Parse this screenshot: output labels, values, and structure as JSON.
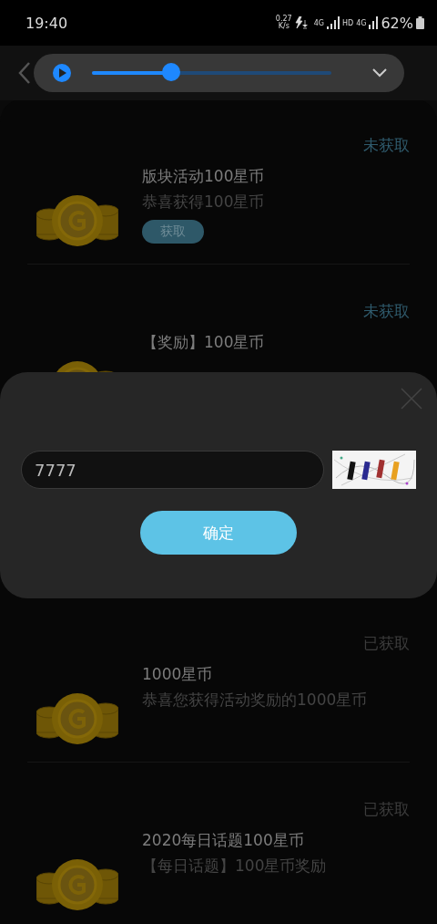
{
  "status_bar": {
    "time": "19:40",
    "speed": "0.27",
    "speed_unit": "K/s",
    "network_a": "4G",
    "network_b": "HD",
    "network_c": "4G",
    "battery": "62%"
  },
  "media": {
    "level": 0.33
  },
  "gifts": [
    {
      "status": "未获取",
      "claimed": false,
      "title": "版块活动100星币",
      "subtitle": "恭喜获得100星币",
      "button": "获取"
    },
    {
      "status": "未获取",
      "claimed": false,
      "title": "【奖励】100星币"
    },
    {
      "status": "已获取",
      "claimed": true,
      "title": "1000星币",
      "subtitle": "恭喜您获得活动奖励的1000星币"
    },
    {
      "status": "已获取",
      "claimed": true,
      "title": "2020每日话题100星币",
      "subtitle": "【每日话题】100星币奖励"
    }
  ],
  "dialog": {
    "code_value": "7777",
    "confirm": "确定"
  }
}
